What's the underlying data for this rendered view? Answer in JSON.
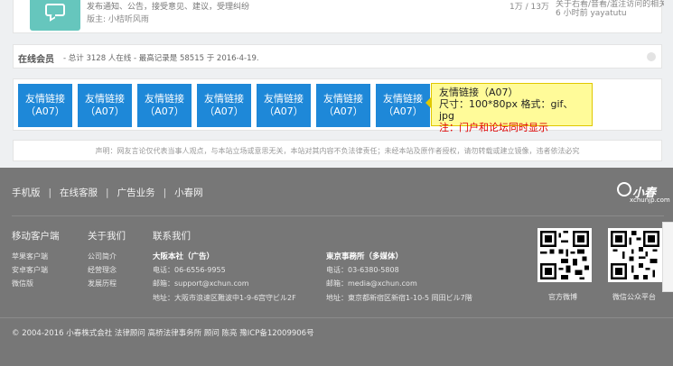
{
  "forum": {
    "desc": "发布通知、公告，接受意见、建议，受理纠纷",
    "moderator": "版主: 小桔听风雨",
    "stats": "1万 / 13万",
    "last_post_title": "关于右看/音看/滥注访问的相关...",
    "last_post_time": "6 小时前 yayatutu"
  },
  "online": {
    "title": "在线会员",
    "summary": "- 总计 3128 人在线 - 最高记录是 58515 于 2016-4-19.",
    "toggle_icon": "collapse-icon"
  },
  "ads": {
    "items": [
      {
        "line1": "友情链接",
        "line2": "（A07）"
      },
      {
        "line1": "友情链接",
        "line2": "（A07）"
      },
      {
        "line1": "友情链接",
        "line2": "（A07）"
      },
      {
        "line1": "友情链接",
        "line2": "（A07）"
      },
      {
        "line1": "友情链接",
        "line2": "（A07）"
      },
      {
        "line1": "友情链接",
        "line2": "（A07）"
      },
      {
        "line1": "友情链接",
        "line2": "（A07）"
      }
    ],
    "tooltip": {
      "line1": "友情链接（A07）",
      "line2": "尺寸：100*80px  格式：gif、jpg",
      "line3": "注：门户和论坛同时显示"
    }
  },
  "disclaimer": "声明：网友言论仅代表当事人观点，与本站立场或意思无关，本站对其内容不负法律责任；未经本站及原作者授权，请勿转载或建立镜像，违者依法必究",
  "footer": {
    "nav": [
      "手机版",
      "在线客服",
      "广告业务",
      "小春网"
    ],
    "logo": {
      "name": "小春",
      "domain": "xchunjp.com"
    },
    "col1": {
      "title": "移动客户端",
      "links": [
        "苹果客户端",
        "安卓客户端",
        "微信版"
      ]
    },
    "col2": {
      "title": "关于我们",
      "links": [
        "公司简介",
        "经营理念",
        "发展历程"
      ]
    },
    "col3": {
      "title": "联系我们",
      "osaka": {
        "title": "大阪本社（广告）",
        "phone": "电话：06-6556-9955",
        "email": "邮箱：support@xchun.com",
        "address": "地址：大阪市浪速区難波中1-9-6宫守ビル2F"
      },
      "tokyo": {
        "title": "東京事務所（多媒体）",
        "phone": "电话：03-6380-5808",
        "email": "邮箱：media@xchun.com",
        "address": "地址：東京都新宿区新宿1-10-5 岡田ビル7階"
      }
    },
    "qr": [
      {
        "label": "官方微博"
      },
      {
        "label": "微信公众平台"
      }
    ],
    "copyright": "© 2004-2016 小春株式会社 法律顾问 高桥法律事务所 顾问 陈亮    豫ICP备12009906号"
  }
}
